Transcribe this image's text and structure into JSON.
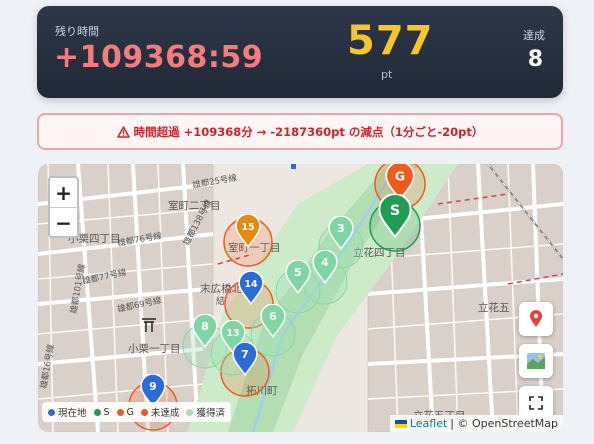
{
  "header": {
    "remaining_label": "残り時間",
    "remaining_value": "+109368:59",
    "points_value": "577",
    "points_unit": "pt",
    "achieved_label": "達成",
    "achieved_value": "8"
  },
  "alert": {
    "icon": "warning-icon",
    "text": "時間超過 +109368分 → -2187360pt の減点（1分ごと-20pt）"
  },
  "map": {
    "zoom_in": "+",
    "zoom_out": "−",
    "place_labels": [
      "室町二丁目",
      "室町一丁目",
      "小栗四丁目",
      "末広橋北",
      "小栗一丁目",
      "立花四丁目",
      "立花五",
      "拓川町",
      "立花五丁目",
      "雄都25号線",
      "雄都76号線",
      "雄都138号線",
      "雄都77号線",
      "雄都101号線",
      "雄都69号線",
      "雄都16号線",
      "結"
    ],
    "markers": [
      {
        "label": "G",
        "color": "#f05a1e"
      },
      {
        "label": "S",
        "color": "#1f9d55"
      },
      {
        "label": "15",
        "color": "#e38a12"
      },
      {
        "label": "14",
        "color": "#2b6cd9"
      },
      {
        "label": "3",
        "color": "#7fd6a4"
      },
      {
        "label": "4",
        "color": "#7fd6a4"
      },
      {
        "label": "5",
        "color": "#7fd6a4"
      },
      {
        "label": "6",
        "color": "#7fd6a4"
      },
      {
        "label": "8",
        "color": "#7fd6a4"
      },
      {
        "label": "13",
        "color": "#7fd6a4"
      },
      {
        "label": "7",
        "color": "#2b6cd9"
      },
      {
        "label": "9",
        "color": "#2b6cd9"
      }
    ],
    "legend": [
      {
        "label": "現在地",
        "color": "#2b6cd9"
      },
      {
        "label": "S",
        "color": "#1f9d55"
      },
      {
        "label": "G",
        "color": "#f05a1e"
      },
      {
        "label": "未達成",
        "color": "#f05a1e"
      },
      {
        "label": "獲得済",
        "color": "#9fe3b8"
      }
    ],
    "attribution": {
      "leaflet": "Leaflet",
      "osm": "| © OpenStreetMap"
    },
    "controls": [
      "pin-icon",
      "map-icon",
      "fullscreen-icon"
    ]
  }
}
